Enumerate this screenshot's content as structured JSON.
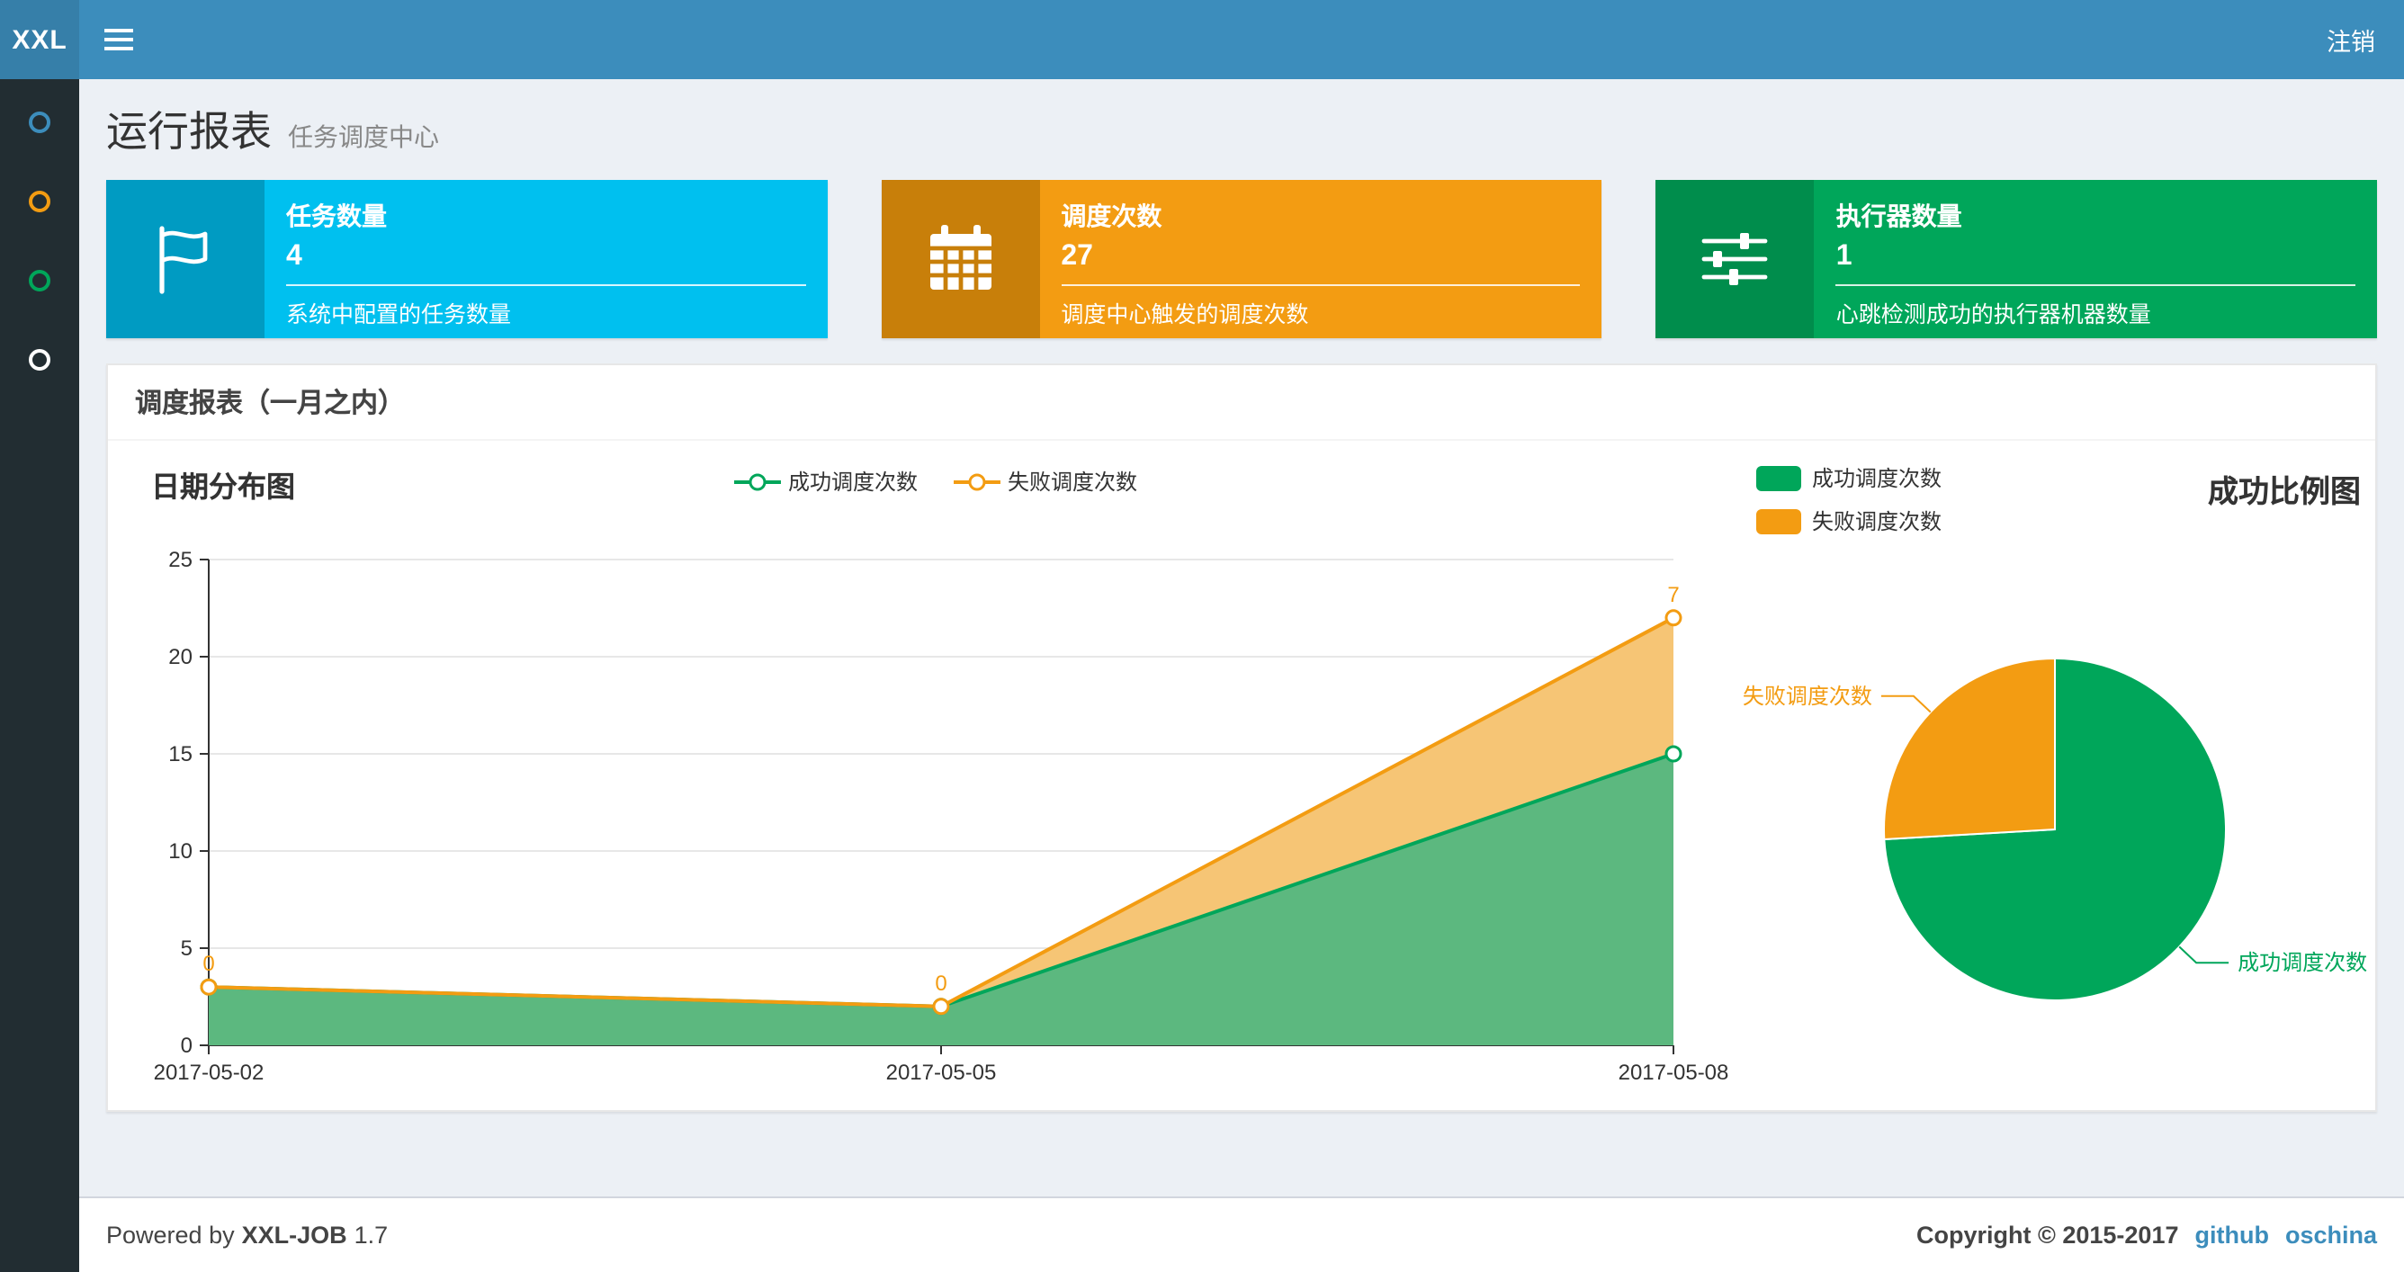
{
  "theme": {
    "navbar_bg": "#3c8dbc",
    "logo_bg": "#367fa9",
    "sidebar_bg": "#222d32",
    "content_bg": "#ecf0f5",
    "link_color": "#3c8dbc",
    "success_color": "#00a65a",
    "warning_color": "#f39c12",
    "info_color": "#00c0ef"
  },
  "navbar": {
    "logo": "XXL",
    "logout": "注销"
  },
  "sidebar": {
    "items": [
      {
        "name": "item-1",
        "icon": "circle-icon",
        "color": "#3c8dbc"
      },
      {
        "name": "item-2",
        "icon": "circle-icon",
        "color": "#f39c12"
      },
      {
        "name": "item-3",
        "icon": "circle-icon",
        "color": "#00a65a"
      },
      {
        "name": "item-4",
        "icon": "circle-icon",
        "color": "#ffffff"
      }
    ]
  },
  "header": {
    "title": "运行报表",
    "subtitle": "任务调度中心"
  },
  "info_boxes": [
    {
      "title": "任务数量",
      "value": "4",
      "desc": "系统中配置的任务数量",
      "color": "#00c0ef",
      "icon_color": "#009bc2",
      "icon": "flag-icon"
    },
    {
      "title": "调度次数",
      "value": "27",
      "desc": "调度中心触发的调度次数",
      "color": "#f39c12",
      "icon_color": "#c87f0a",
      "icon": "calendar-icon"
    },
    {
      "title": "执行器数量",
      "value": "1",
      "desc": "心跳检测成功的执行器机器数量",
      "color": "#00a65a",
      "icon_color": "#008d4c",
      "icon": "sliders-icon"
    }
  ],
  "panel": {
    "title": "调度报表（一月之内）"
  },
  "chart_data": [
    {
      "type": "area",
      "title": "日期分布图",
      "categories": [
        "2017-05-02",
        "2017-05-05",
        "2017-05-08"
      ],
      "series": [
        {
          "name": "成功调度次数",
          "values": [
            3,
            2,
            15
          ],
          "color": "#00a65a",
          "fill": "#5cb87f"
        },
        {
          "name": "失败调度次数",
          "values": [
            0,
            0,
            7
          ],
          "color": "#f39c12",
          "fill": "#f6c575"
        }
      ],
      "stacked": true,
      "point_labels": [
        "0",
        "0",
        "7"
      ],
      "ylim": [
        0,
        25
      ],
      "yticks": [
        0,
        5,
        10,
        15,
        20,
        25
      ],
      "xlabel": "",
      "ylabel": "",
      "grid": true,
      "legend_position": "top-center"
    },
    {
      "type": "pie",
      "title": "成功比例图",
      "slices": [
        {
          "name": "成功调度次数",
          "value": 20,
          "color": "#00a65a"
        },
        {
          "name": "失败调度次数",
          "value": 7,
          "color": "#f39c12"
        }
      ],
      "legend_position": "top-left"
    }
  ],
  "footer": {
    "powered_by": "Powered by",
    "app_name": "XXL-JOB",
    "version": "1.7",
    "copyright": "Copyright © 2015-2017",
    "links": [
      {
        "label": "github"
      },
      {
        "label": "oschina"
      }
    ]
  }
}
